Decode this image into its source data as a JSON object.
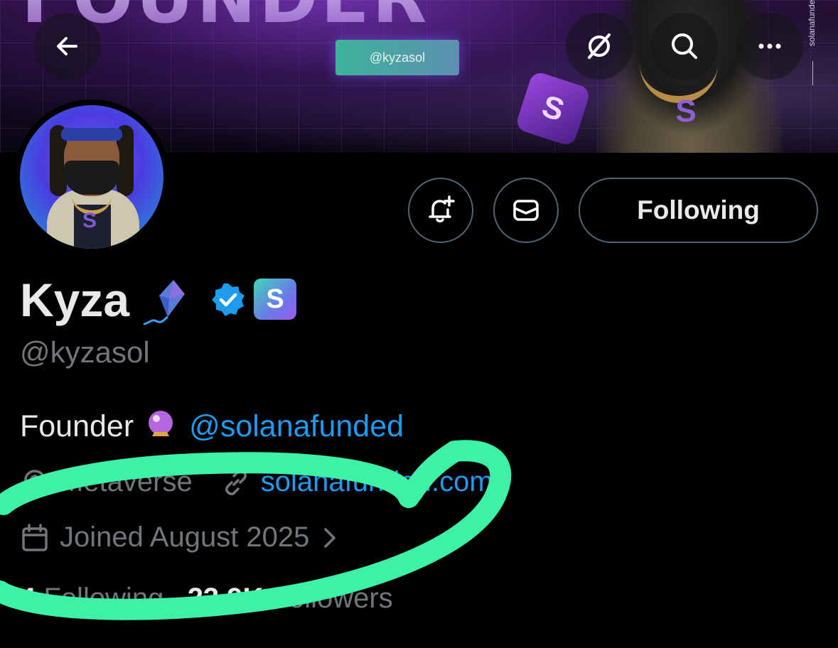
{
  "banner": {
    "big_word": "FOUNDER",
    "handle_card": "@kyzasol",
    "side_text": "solanafunde"
  },
  "header_icons": [
    "back-arrow-icon",
    "grok-icon",
    "search-icon",
    "more-icon"
  ],
  "actions": {
    "notify_icon": "bell-plus-icon",
    "message_icon": "mail-icon",
    "follow_label": "Following"
  },
  "profile": {
    "name": "Kyza",
    "handle": "@kyzasol",
    "bio_text": "Founder",
    "bio_mention": "@solanafunded",
    "location": "Metaverse",
    "website": "solanafunded.com",
    "joined": "Joined August 2025",
    "following_count": "4",
    "following_label": "Following",
    "followers_count": "23.9K",
    "followers_label": "Followers"
  },
  "colors": {
    "accent": "#1d9bf0",
    "muted": "#71767b",
    "annotation": "#3df2a6"
  }
}
